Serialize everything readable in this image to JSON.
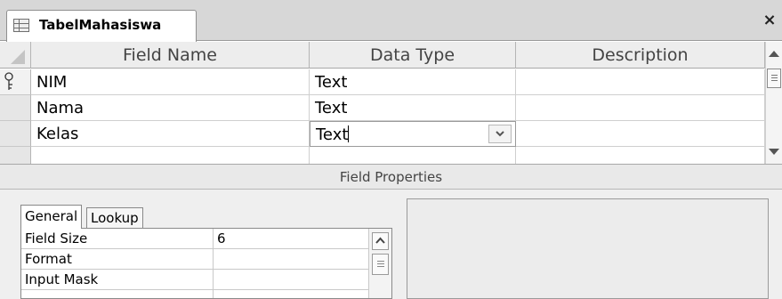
{
  "document_tab": {
    "title": "TabelMahasiswa",
    "icon": "table-icon",
    "close_glyph": "×"
  },
  "grid": {
    "columns": [
      "Field Name",
      "Data Type",
      "Description"
    ],
    "rows": [
      {
        "field_name": "NIM",
        "data_type": "Text",
        "description": "",
        "primary_key": true
      },
      {
        "field_name": "Nama",
        "data_type": "Text",
        "description": ""
      },
      {
        "field_name": "Kelas",
        "data_type": "Text",
        "description": "",
        "editing": true
      }
    ]
  },
  "field_properties": {
    "title": "Field Properties",
    "tabs": [
      "General",
      "Lookup"
    ],
    "active_tab": "General",
    "properties": [
      {
        "name": "Field Size",
        "value": "6"
      },
      {
        "name": "Format",
        "value": ""
      },
      {
        "name": "Input Mask",
        "value": ""
      }
    ]
  }
}
